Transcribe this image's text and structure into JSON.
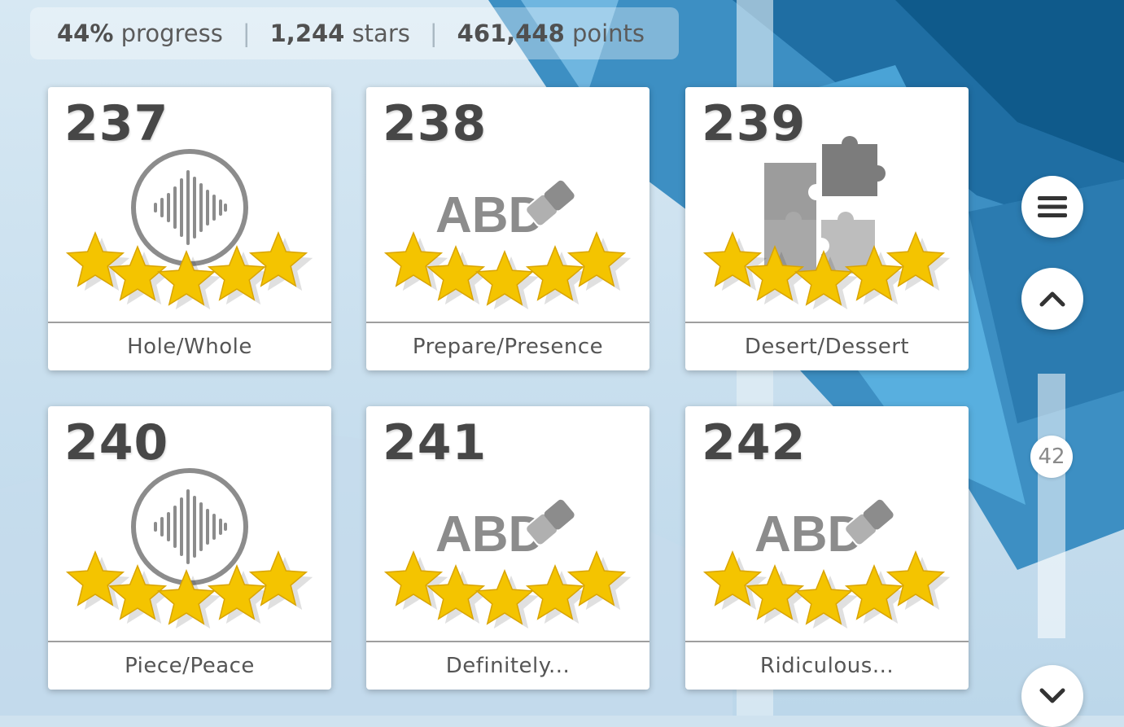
{
  "stats": {
    "progress_value": "44%",
    "progress_label": "progress",
    "stars_value": "1,244",
    "stars_label": "stars",
    "points_value": "461,448",
    "points_label": "points",
    "separator": "|"
  },
  "levels": [
    {
      "number": "237",
      "title": "Hole/Whole",
      "icon": "sound-wave-icon",
      "stars": 5
    },
    {
      "number": "238",
      "title": "Prepare/Presence",
      "icon": "eraser-abc-icon",
      "icon_text": "ABD",
      "stars": 5
    },
    {
      "number": "239",
      "title": "Desert/Dessert",
      "icon": "puzzle-icon",
      "stars": 5
    },
    {
      "number": "240",
      "title": "Piece/Peace",
      "icon": "sound-wave-icon",
      "stars": 5
    },
    {
      "number": "241",
      "title": "Definitely...",
      "icon": "eraser-abc-icon",
      "icon_text": "ABD",
      "stars": 5
    },
    {
      "number": "242",
      "title": "Ridiculous...",
      "icon": "eraser-abc-icon",
      "icon_text": "ABD",
      "stars": 5
    }
  ],
  "sidebar": {
    "menu_icon": "hamburger-menu-icon",
    "up_icon": "chevron-up-icon",
    "down_icon": "chevron-down-icon",
    "scroll_position": "42"
  },
  "colors": {
    "star": "#f4c400",
    "icon_gray": "#8c8c8c",
    "number": "#474747"
  }
}
